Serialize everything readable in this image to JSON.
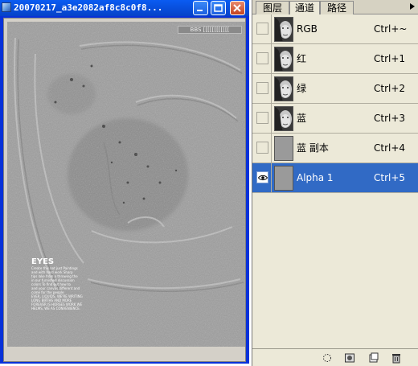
{
  "window": {
    "title": "20070217_a3e2082af8c8c0f8..."
  },
  "canvas": {
    "watermark": "BBS [[[[[[[[[[[[",
    "eyes_title": "EYES",
    "eyes_lines": [
      "Create this not just Paintings",
      "and with hard work Sharp",
      "tips lake from a throwing the",
      "in our furnished discussion",
      "colors To find out how to",
      "and your canvas different and",
      "come for the people",
      "EVER, LIQUIDS, WE'RE WRITING",
      "LONG BIRTHS AND MORE",
      "FOREVER IS HORSES WORK WE",
      "HELMS, WE AS CONVENIENCE."
    ]
  },
  "panel": {
    "tabs": [
      "图层",
      "通道",
      "路径"
    ],
    "active_tab": "通道",
    "menu_icon": "triangle-right-icon",
    "channels": [
      {
        "name": "RGB",
        "shortcut": "Ctrl+~",
        "visible": false,
        "selected": false,
        "thumb": "face"
      },
      {
        "name": "红",
        "shortcut": "Ctrl+1",
        "visible": false,
        "selected": false,
        "thumb": "face"
      },
      {
        "name": "绿",
        "shortcut": "Ctrl+2",
        "visible": false,
        "selected": false,
        "thumb": "face"
      },
      {
        "name": "蓝",
        "shortcut": "Ctrl+3",
        "visible": false,
        "selected": false,
        "thumb": "face"
      },
      {
        "name": "蓝 副本",
        "shortcut": "Ctrl+4",
        "visible": false,
        "selected": false,
        "thumb": "gray"
      },
      {
        "name": "Alpha 1",
        "shortcut": "Ctrl+5",
        "visible": true,
        "selected": true,
        "thumb": "gray"
      }
    ],
    "footer_icons": [
      "load-selection-icon",
      "save-selection-icon",
      "new-channel-icon",
      "delete-channel-icon"
    ]
  },
  "colors": {
    "title_bar": "#0a5cf2",
    "selection": "#316ac5",
    "panel_bg": "#ece9d8"
  }
}
